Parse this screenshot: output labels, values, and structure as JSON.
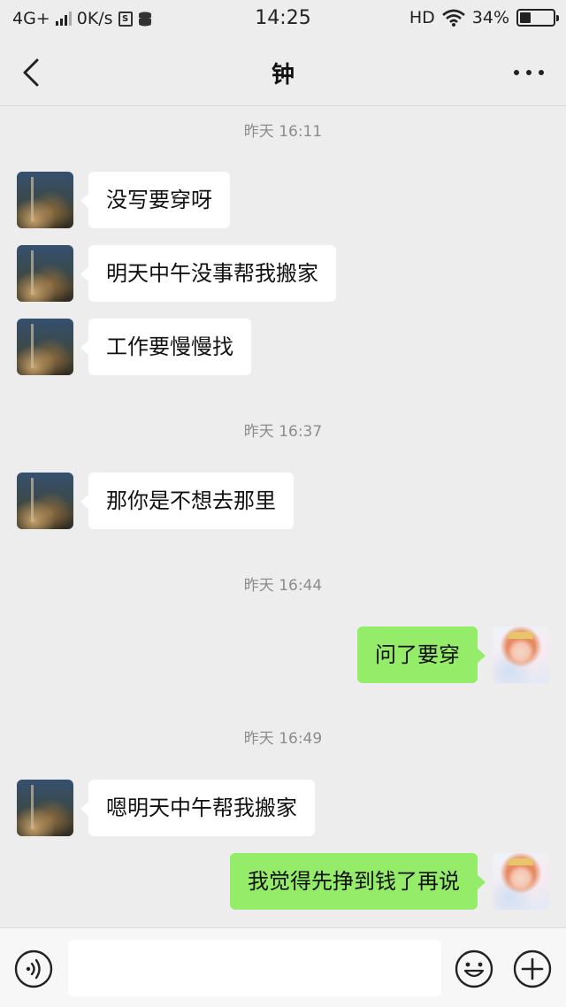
{
  "status_bar": {
    "network": "4G+",
    "speed": "0K/s",
    "time": "14:25",
    "hd": "HD",
    "battery": "34%",
    "icons": [
      "signal-icon",
      "s-box-icon",
      "data-icon",
      "wifi-icon",
      "battery-icon"
    ]
  },
  "header": {
    "title": "钟",
    "back_icon": "chevron-left-icon",
    "more_icon": "more-dots-icon"
  },
  "messages": {
    "t1": "昨天 16:11",
    "m1": "没写要穿呀",
    "m2": "明天中午没事帮我搬家",
    "m3": "工作要慢慢找",
    "t2": "昨天 16:37",
    "m4": "那你是不想去那里",
    "t3": "昨天 16:44",
    "m5": "问了要穿",
    "t4": "昨天 16:49",
    "m6": "嗯明天中午帮我搬家",
    "m7": "我觉得先挣到钱了再说"
  },
  "input_bar": {
    "value": "",
    "placeholder": "",
    "icons": [
      "voice-icon",
      "emoji-icon",
      "plus-icon"
    ]
  },
  "colors": {
    "background": "#ededed",
    "bubble_self": "#95ec69",
    "bubble_other": "#ffffff",
    "timestamp": "#8c8c8c"
  }
}
